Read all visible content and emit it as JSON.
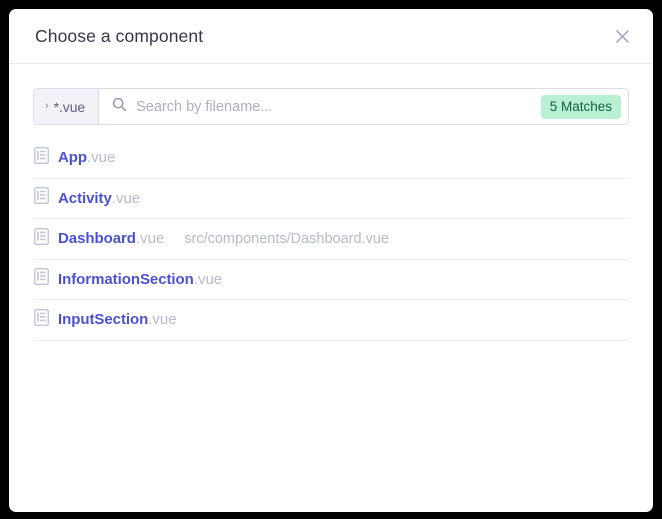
{
  "dialog": {
    "title": "Choose a component",
    "close_icon": "close-icon"
  },
  "search": {
    "filter_chip": {
      "caret": "›",
      "label": "*.vue"
    },
    "icon": "search-icon",
    "value": "",
    "placeholder": "Search by filename...",
    "match_badge": "5 Matches",
    "badge_bg": "#b9f0d4",
    "badge_fg": "#10633f"
  },
  "results": {
    "icon": "file-document-icon",
    "items": [
      {
        "name": "App",
        "ext": ".vue",
        "path": ""
      },
      {
        "name": "Activity",
        "ext": ".vue",
        "path": ""
      },
      {
        "name": "Dashboard",
        "ext": ".vue",
        "path": "src/components/Dashboard.vue"
      },
      {
        "name": "InformationSection",
        "ext": ".vue",
        "path": ""
      },
      {
        "name": "InputSection",
        "ext": ".vue",
        "path": ""
      }
    ]
  },
  "colors": {
    "accent": "#4b51d6",
    "muted": "#b6bacb",
    "title": "#33384d",
    "backdrop": "#000000"
  }
}
